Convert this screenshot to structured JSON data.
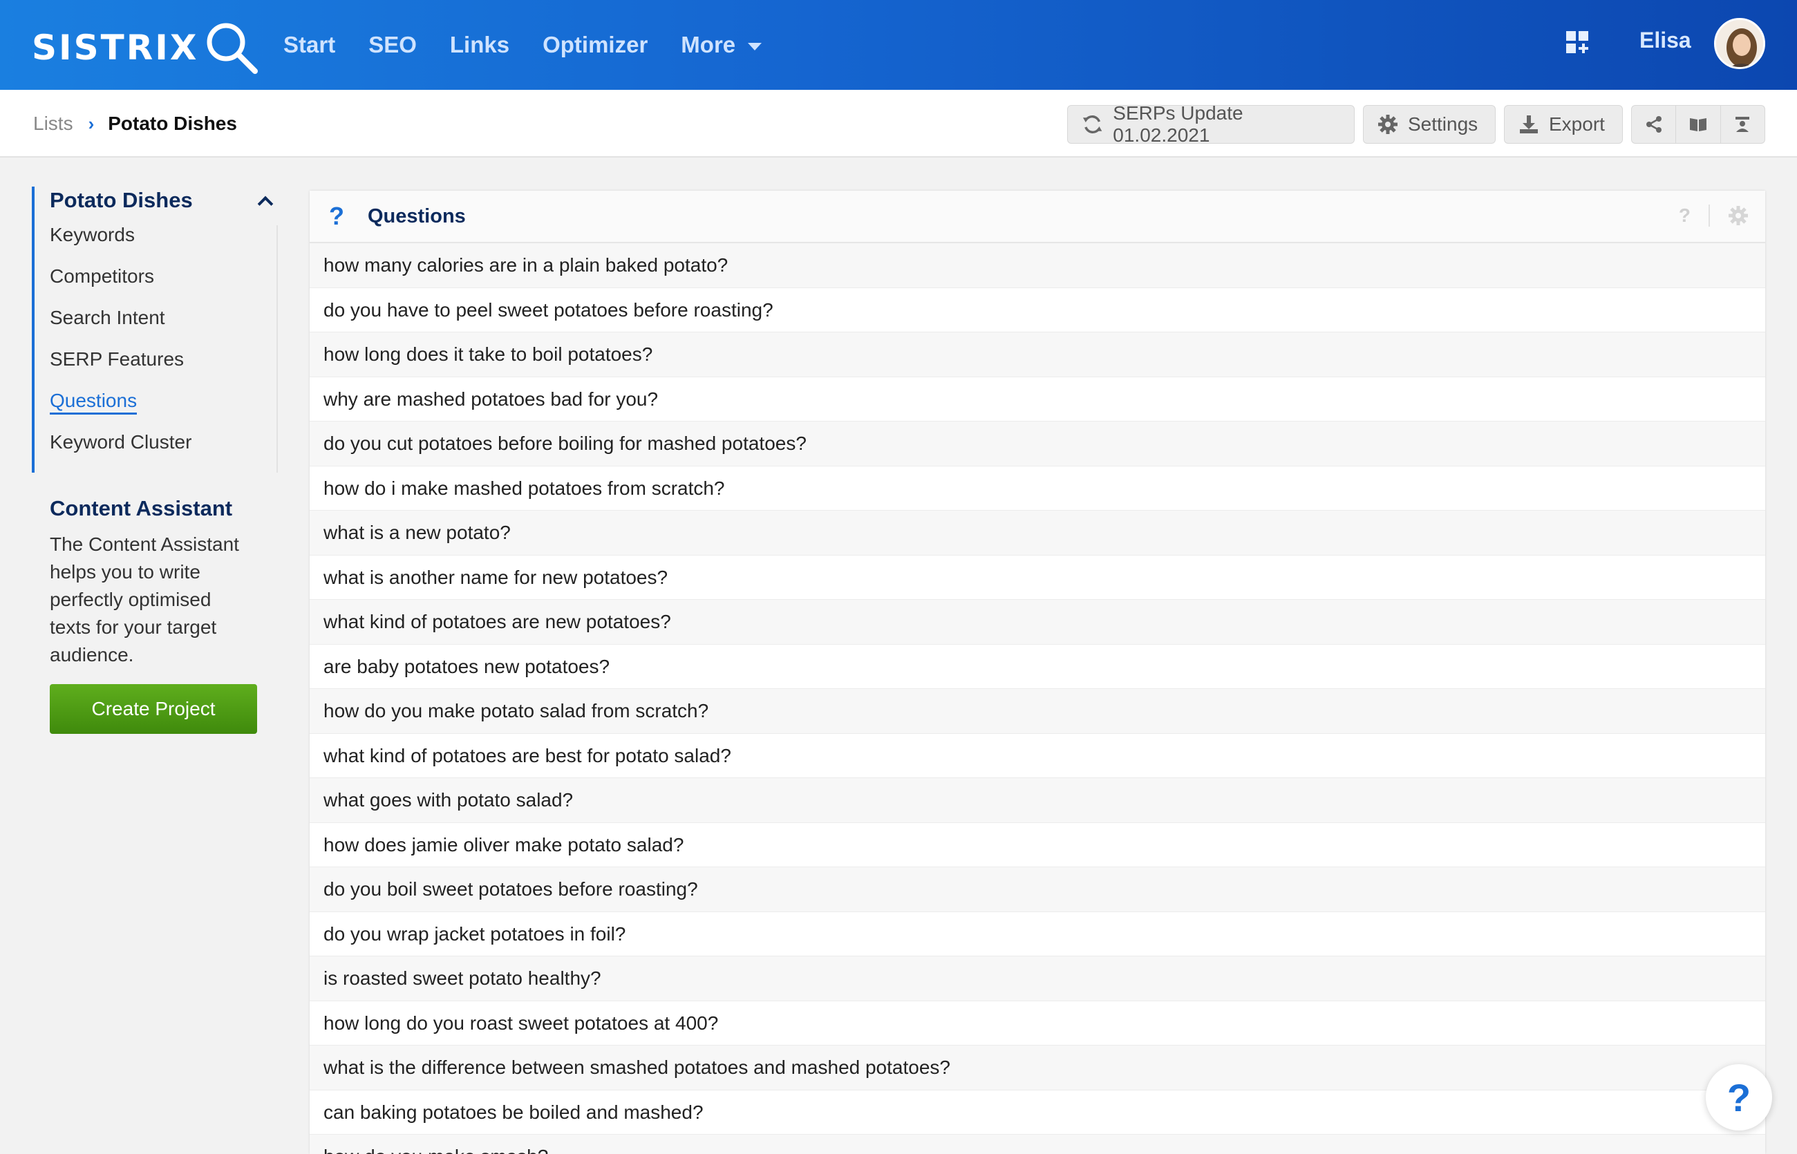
{
  "header": {
    "logo_text": "SISTRIX",
    "nav": [
      {
        "label": "Start"
      },
      {
        "label": "SEO"
      },
      {
        "label": "Links"
      },
      {
        "label": "Optimizer"
      },
      {
        "label": "More"
      }
    ],
    "user_name": "Elisa"
  },
  "breadcrumb": {
    "root": "Lists",
    "current": "Potato Dishes"
  },
  "toolbar": {
    "serps_update": "SERPs Update 01.02.2021",
    "settings": "Settings",
    "export": "Export"
  },
  "sidebar": {
    "title": "Potato Dishes",
    "items": [
      {
        "label": "Keywords"
      },
      {
        "label": "Competitors"
      },
      {
        "label": "Search Intent"
      },
      {
        "label": "SERP Features"
      },
      {
        "label": "Questions"
      },
      {
        "label": "Keyword Cluster"
      }
    ],
    "active_item": "Questions",
    "content_assistant": {
      "title": "Content Assistant",
      "text": "The Content Assistant helps you to write perfectly optimised texts for your target audience.",
      "button": "Create Project"
    }
  },
  "panel": {
    "icon": "?",
    "title": "Questions",
    "help_icon": "?",
    "questions": [
      "how many calories are in a plain baked potato?",
      "do you have to peel sweet potatoes before roasting?",
      "how long does it take to boil potatoes?",
      "why are mashed potatoes bad for you?",
      "do you cut potatoes before boiling for mashed potatoes?",
      "how do i make mashed potatoes from scratch?",
      "what is a new potato?",
      "what is another name for new potatoes?",
      "what kind of potatoes are new potatoes?",
      "are baby potatoes new potatoes?",
      "how do you make potato salad from scratch?",
      "what kind of potatoes are best for potato salad?",
      "what goes with potato salad?",
      "how does jamie oliver make potato salad?",
      "do you boil sweet potatoes before roasting?",
      "do you wrap jacket potatoes in foil?",
      "is roasted sweet potato healthy?",
      "how long do you roast sweet potatoes at 400?",
      "what is the difference between smashed potatoes and mashed potatoes?",
      "can baking potatoes be boiled and mashed?",
      "how do you make smash?"
    ]
  },
  "help_fab": "?",
  "colors": {
    "header_start": "#1a7fe0",
    "header_end": "#0c47b0",
    "accent": "#1b6fd6",
    "title_navy": "#0c2a5c",
    "button_green": "#4a9a12"
  },
  "icons": [
    "search-icon",
    "caret-down-icon",
    "apps-grid-icon",
    "refresh-icon",
    "gear-icon",
    "download-icon",
    "share-icon",
    "book-icon",
    "profile-icon",
    "chevron-up-icon",
    "question-icon"
  ]
}
